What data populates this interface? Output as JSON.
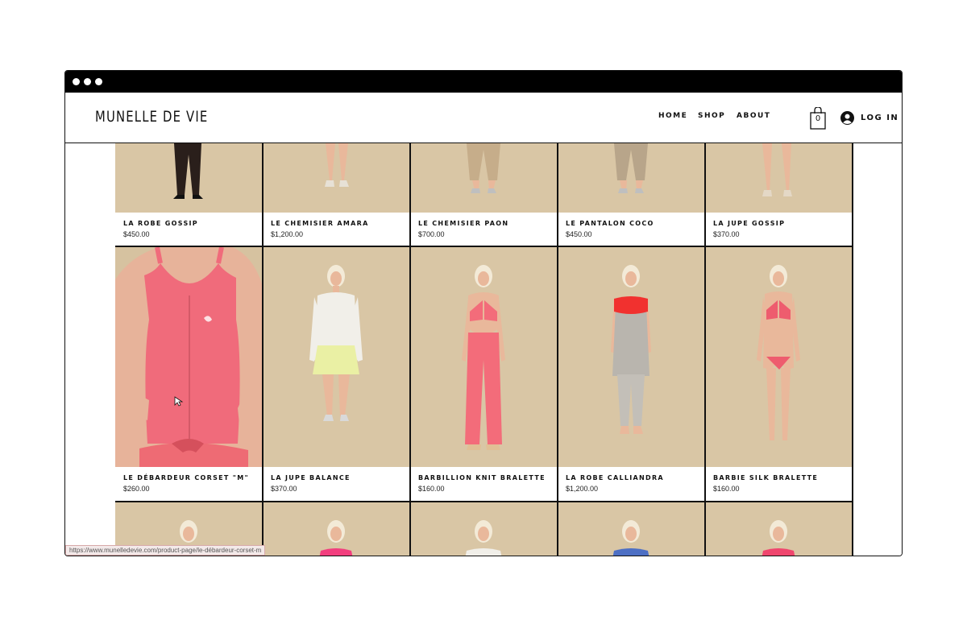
{
  "brand": {
    "name": "MUNELLE DE VIE"
  },
  "nav": {
    "home": "HOME",
    "shop": "SHOP",
    "about": "ABOUT"
  },
  "cart": {
    "count": "0"
  },
  "login": {
    "label": "LOG IN"
  },
  "colors": {
    "backdrop": "#d9c6a5",
    "pink": "#f06a7a",
    "black": "#111111"
  },
  "products": {
    "row1": [
      {
        "name": "LA ROBE GOSSIP",
        "price": "$450.00"
      },
      {
        "name": "LE CHEMISIER AMARA",
        "price": "$1,200.00"
      },
      {
        "name": "LE CHEMISIER PAON",
        "price": "$700.00"
      },
      {
        "name": "LE PANTALON COCO",
        "price": "$450.00"
      },
      {
        "name": "LA JUPE GOSSIP",
        "price": "$370.00"
      }
    ],
    "row2": [
      {
        "name": "LE DÉBARDEUR CORSET \"M\"",
        "price": "$260.00"
      },
      {
        "name": "LA JUPE BALANCE",
        "price": "$370.00"
      },
      {
        "name": "BARBILLION KNIT BRALETTE",
        "price": "$160.00"
      },
      {
        "name": "LA ROBE CALLIANDRA",
        "price": "$1,200.00"
      },
      {
        "name": "BARBIE SILK BRALETTE",
        "price": "$160.00"
      }
    ]
  },
  "status": {
    "url": "https://www.munelledevie.com/product-page/le-débardeur-corset-m"
  }
}
